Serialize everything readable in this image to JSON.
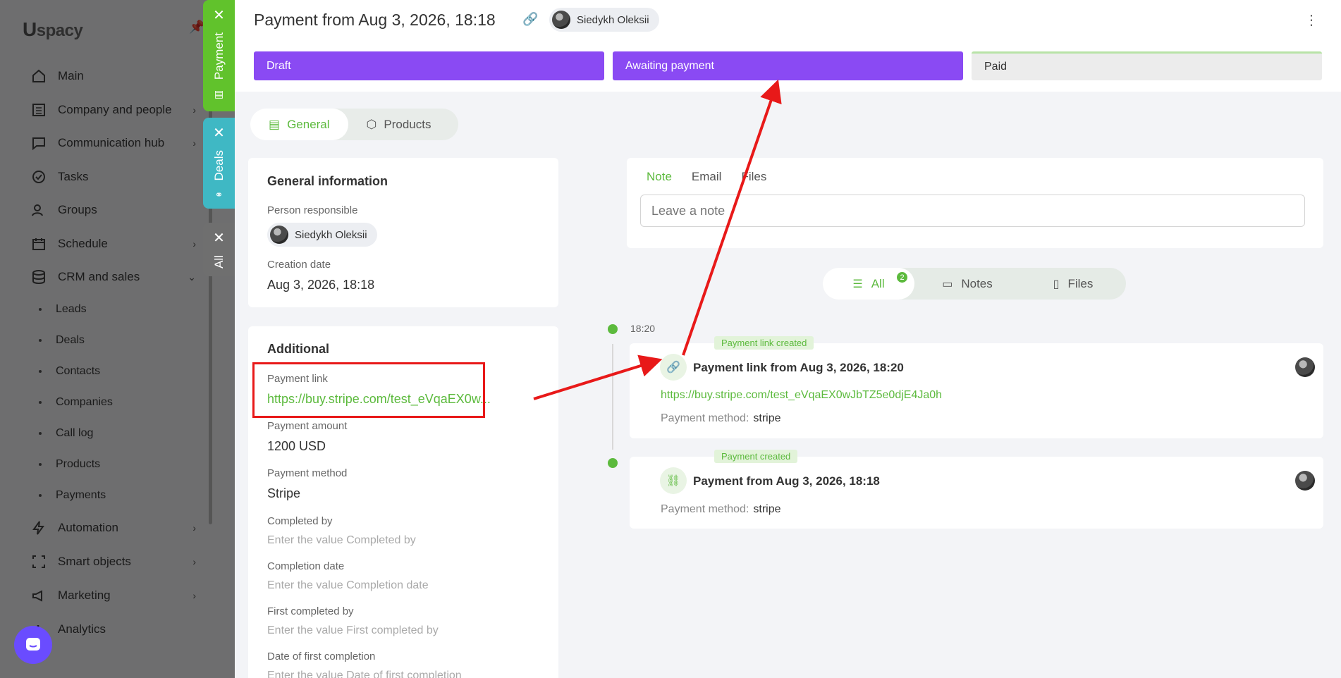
{
  "sidebar": {
    "logo": "spacy",
    "nav": [
      {
        "label": "Main",
        "icon": "home-icon"
      },
      {
        "label": "Company and people",
        "icon": "building-icon"
      },
      {
        "label": "Communication hub",
        "icon": "chat-icon"
      },
      {
        "label": "Tasks",
        "icon": "check-circle-icon"
      },
      {
        "label": "Groups",
        "icon": "people-icon"
      },
      {
        "label": "Schedule",
        "icon": "calendar-icon"
      },
      {
        "label": "CRM and sales",
        "icon": "database-icon"
      }
    ],
    "crm_items": [
      "Leads",
      "Deals",
      "Contacts",
      "Companies",
      "Call log",
      "Products",
      "Payments"
    ],
    "nav_bottom": [
      {
        "label": "Automation",
        "icon": "lightning-icon"
      },
      {
        "label": "Smart objects",
        "icon": "scan-icon"
      },
      {
        "label": "Marketing",
        "icon": "megaphone-icon"
      },
      {
        "label": "Analytics",
        "icon": "chart-icon"
      }
    ]
  },
  "vertical_tabs": [
    {
      "label": "Payment",
      "color": "#61c22c"
    },
    {
      "label": "Deals",
      "color": "#3fb8c4"
    },
    {
      "label": "All",
      "color": "#6f6f6f"
    }
  ],
  "header": {
    "title": "Payment from Aug 3, 2026, 18:18",
    "responsible_chip": "Siedykh Oleksii"
  },
  "stages": [
    {
      "label": "Draft",
      "active": true
    },
    {
      "label": "Awaiting payment",
      "active": true
    },
    {
      "label": "Paid",
      "active": false
    }
  ],
  "view_tabs": {
    "general": "General",
    "products": "Products"
  },
  "general_info": {
    "title": "General information",
    "person_label": "Person responsible",
    "person_value": "Siedykh Oleksii",
    "creation_label": "Creation date",
    "creation_value": "Aug 3, 2026, 18:18"
  },
  "additional": {
    "title": "Additional",
    "payment_link_label": "Payment link",
    "payment_link_value": "https://buy.stripe.com/test_eVqaEX0w...",
    "payment_amount_label": "Payment amount",
    "payment_amount_value": "1200 USD",
    "payment_method_label": "Payment method",
    "payment_method_value": "Stripe",
    "completed_by_label": "Completed by",
    "completed_by_placeholder": "Enter the value Completed by",
    "completion_date_label": "Completion date",
    "completion_date_placeholder": "Enter the value Completion date",
    "first_completed_by_label": "First completed by",
    "first_completed_by_placeholder": "Enter the value First completed by",
    "first_completion_date_label": "Date of first completion",
    "first_completion_date_placeholder": "Enter the value Date of first completion"
  },
  "note_card": {
    "tabs": [
      "Note",
      "Email",
      "Files"
    ],
    "placeholder": "Leave a note"
  },
  "feed_filter": {
    "all": "All",
    "all_count": "2",
    "notes": "Notes",
    "files": "Files"
  },
  "timeline": {
    "time": "18:20",
    "events": [
      {
        "tag": "Payment link created",
        "title": "Payment link from Aug 3, 2026, 18:20",
        "link": "https://buy.stripe.com/test_eVqaEX0wJbTZ5e0djE4Ja0h",
        "method_label": "Payment method:",
        "method_value": "stripe"
      },
      {
        "tag": "Payment created",
        "title": "Payment from Aug 3, 2026, 18:18",
        "method_label": "Payment method:",
        "method_value": "stripe"
      }
    ]
  },
  "colors": {
    "accent_green": "#5cba3d",
    "stage_purple": "#8a4af3",
    "annotation_red": "#e81919"
  }
}
